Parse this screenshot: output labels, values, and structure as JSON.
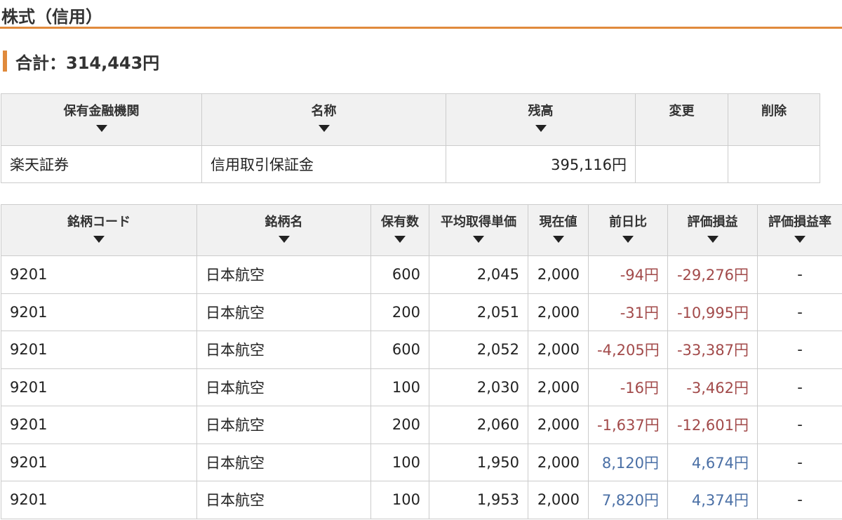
{
  "section": {
    "title": "株式（信用）"
  },
  "summary": {
    "total": "合計：314,443円"
  },
  "colors": {
    "accent": "#e08a3c",
    "negative": "#a24a4a",
    "positive": "#4a6fa5",
    "header_bg": "#f1f1f1"
  },
  "sort_icon": "triangle-down-icon",
  "accounts": {
    "headers": {
      "institution": "保有金融機関",
      "name": "名称",
      "balance": "残高",
      "edit": "変更",
      "delete": "削除"
    },
    "rows": [
      {
        "institution": "楽天証券",
        "name": "信用取引保証金",
        "balance": "395,116円",
        "edit": "",
        "delete": ""
      }
    ]
  },
  "holdings": {
    "headers": {
      "code": "銘柄コード",
      "name": "銘柄名",
      "quantity": "保有数",
      "avg_cost": "平均取得単価",
      "price": "現在値",
      "day_change": "前日比",
      "pnl": "評価損益",
      "pnl_rate": "評価損益率"
    },
    "rows": [
      {
        "code": "9201",
        "name": "日本航空",
        "quantity": "600",
        "avg_cost": "2,045",
        "price": "2,000",
        "day_change": "-94円",
        "pnl": "-29,276円",
        "pnl_rate": "-"
      },
      {
        "code": "9201",
        "name": "日本航空",
        "quantity": "200",
        "avg_cost": "2,051",
        "price": "2,000",
        "day_change": "-31円",
        "pnl": "-10,995円",
        "pnl_rate": "-"
      },
      {
        "code": "9201",
        "name": "日本航空",
        "quantity": "600",
        "avg_cost": "2,052",
        "price": "2,000",
        "day_change": "-4,205円",
        "pnl": "-33,387円",
        "pnl_rate": "-"
      },
      {
        "code": "9201",
        "name": "日本航空",
        "quantity": "100",
        "avg_cost": "2,030",
        "price": "2,000",
        "day_change": "-16円",
        "pnl": "-3,462円",
        "pnl_rate": "-"
      },
      {
        "code": "9201",
        "name": "日本航空",
        "quantity": "200",
        "avg_cost": "2,060",
        "price": "2,000",
        "day_change": "-1,637円",
        "pnl": "-12,601円",
        "pnl_rate": "-"
      },
      {
        "code": "9201",
        "name": "日本航空",
        "quantity": "100",
        "avg_cost": "1,950",
        "price": "2,000",
        "day_change": "8,120円",
        "pnl": "4,674円",
        "pnl_rate": "-"
      },
      {
        "code": "9201",
        "name": "日本航空",
        "quantity": "100",
        "avg_cost": "1,953",
        "price": "2,000",
        "day_change": "7,820円",
        "pnl": "4,374円",
        "pnl_rate": "-"
      }
    ]
  }
}
